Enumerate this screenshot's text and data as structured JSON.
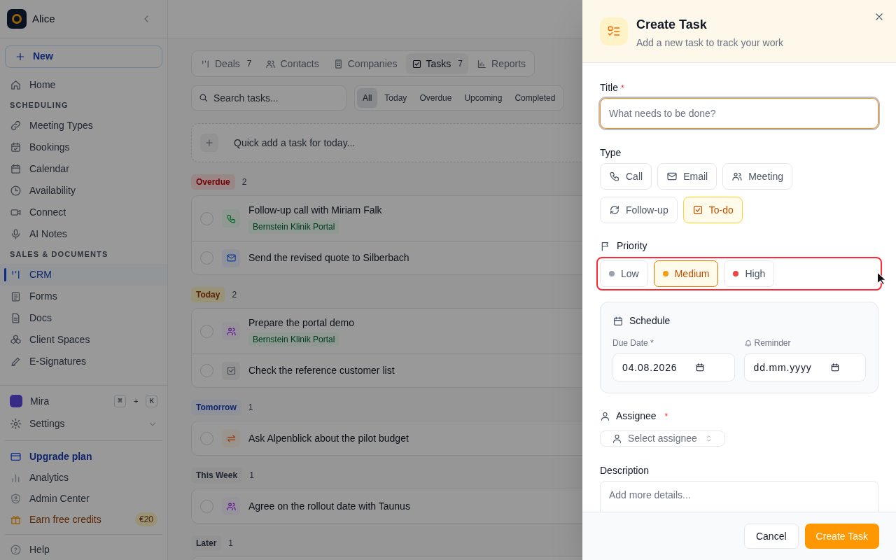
{
  "sidebar": {
    "workspace": "Alice",
    "new_button": "New",
    "nav": [
      {
        "kind": "item",
        "label": "Home",
        "selected": false
      },
      {
        "kind": "section",
        "label": "SCHEDULING"
      },
      {
        "kind": "item",
        "label": "Meeting Types",
        "selected": false
      },
      {
        "kind": "item",
        "label": "Bookings",
        "selected": false
      },
      {
        "kind": "item",
        "label": "Calendar",
        "selected": false
      },
      {
        "kind": "item",
        "label": "Availability",
        "selected": false
      },
      {
        "kind": "item",
        "label": "Connect",
        "selected": false
      },
      {
        "kind": "item",
        "label": "AI Notes",
        "selected": false
      },
      {
        "kind": "section",
        "label": "SALES & DOCUMENTS"
      },
      {
        "kind": "item",
        "label": "CRM",
        "selected": true
      },
      {
        "kind": "item",
        "label": "Forms",
        "selected": false
      },
      {
        "kind": "item",
        "label": "Docs",
        "selected": false
      },
      {
        "kind": "item",
        "label": "Client Spaces",
        "selected": false
      },
      {
        "kind": "item",
        "label": "E-Signatures",
        "selected": false
      }
    ],
    "assistant": {
      "label": "Mira",
      "shortcut": [
        "⌘",
        "+",
        "K"
      ]
    },
    "settings": {
      "label": "Settings",
      "expanded": false
    },
    "footer": [
      {
        "kind": "upgrade",
        "label": "Upgrade plan"
      },
      {
        "kind": "plain",
        "label": "Analytics"
      },
      {
        "kind": "plain",
        "label": "Admin Center"
      },
      {
        "kind": "credits",
        "label": "Earn free credits",
        "badge": "€20"
      }
    ],
    "help": "Help"
  },
  "main": {
    "tabs": [
      {
        "label": "Deals",
        "count": "7",
        "selected": false
      },
      {
        "label": "Contacts",
        "selected": false
      },
      {
        "label": "Companies",
        "selected": false
      },
      {
        "label": "Tasks",
        "count": "7",
        "selected": true
      },
      {
        "label": "Reports",
        "selected": false
      }
    ],
    "search": {
      "placeholder": "Search tasks..."
    },
    "filters": [
      {
        "label": "All",
        "selected": true
      },
      {
        "label": "Today",
        "selected": false
      },
      {
        "label": "Overdue",
        "selected": false
      },
      {
        "label": "Upcoming",
        "selected": false
      },
      {
        "label": "Completed",
        "selected": false
      }
    ],
    "quick_add": {
      "placeholder": "Quick add a task for today..."
    },
    "groups": [
      {
        "label": "Overdue",
        "count": "2",
        "kind": "overdue",
        "tasks": [
          {
            "title": "Follow-up call with Miriam Falk",
            "kind": "call",
            "tag": "Bernstein Klinik Portal",
            "completed": false
          },
          {
            "title": "Send the revised quote to Silberbach",
            "kind": "email",
            "completed": false
          }
        ]
      },
      {
        "label": "Today",
        "count": "2",
        "kind": "today",
        "tasks": [
          {
            "title": "Prepare the portal demo",
            "kind": "meeting",
            "tag": "Bernstein Klinik Portal",
            "completed": false
          },
          {
            "title": "Check the reference customer list",
            "kind": "todo",
            "completed": false
          }
        ]
      },
      {
        "label": "Tomorrow",
        "count": "1",
        "kind": "tomorrow",
        "tasks": [
          {
            "title": "Ask Alpenblick about the pilot budget",
            "kind": "followup",
            "completed": false
          }
        ]
      },
      {
        "label": "This Week",
        "count": "1",
        "kind": "neutral",
        "tasks": [
          {
            "title": "Agree on the rollout date with Taunus",
            "kind": "meeting",
            "completed": false
          }
        ]
      },
      {
        "label": "Later",
        "count": "1",
        "kind": "neutral"
      }
    ]
  },
  "dialog": {
    "title": "Create Task",
    "subtitle": "Add a new task to track your work",
    "title_field": {
      "label": "Title",
      "required_mark": "*",
      "placeholder": "What needs to be done?"
    },
    "type": {
      "label": "Type",
      "options": [
        {
          "label": "Call",
          "kind": "call",
          "selected": false
        },
        {
          "label": "Email",
          "kind": "email",
          "selected": false
        },
        {
          "label": "Meeting",
          "kind": "meeting",
          "selected": false
        },
        {
          "label": "Follow-up",
          "kind": "followup",
          "selected": false
        },
        {
          "label": "To-do",
          "kind": "todo",
          "selected": true
        }
      ]
    },
    "priority": {
      "label": "Priority",
      "highlighted": true,
      "options": [
        {
          "label": "Low",
          "color": "#9ca3af",
          "selected": false
        },
        {
          "label": "Medium",
          "color": "#f59e0b",
          "selected": true
        },
        {
          "label": "High",
          "color": "#ef4444",
          "selected": false
        }
      ]
    },
    "schedule": {
      "label": "Schedule",
      "due_date": {
        "label": "Due Date *",
        "value": "04.08.2026"
      },
      "reminder": {
        "label": "Reminder",
        "placeholder": "dd.mm.yyyy"
      }
    },
    "assignee": {
      "label": "Assignee",
      "required_mark": "*",
      "placeholder": "Select assignee"
    },
    "description": {
      "label": "Description",
      "placeholder": "Add more details..."
    },
    "buttons": [
      {
        "label": "Cancel",
        "kind": "secondary"
      },
      {
        "label": "Create Task",
        "kind": "primary"
      }
    ]
  }
}
